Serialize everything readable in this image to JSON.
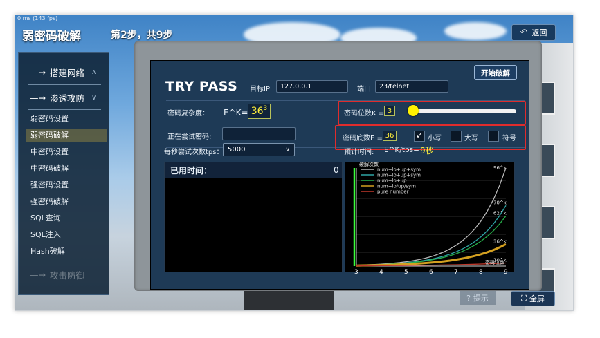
{
  "window": {
    "fps": "0 ms (143 fps)"
  },
  "header": {
    "app_title": "弱密码破解",
    "step": "第2步，共9步",
    "back_label": "返回",
    "back_icon": "back-arrow-icon"
  },
  "sidebar": {
    "sections": [
      {
        "label": "搭建网络",
        "expanded": false
      },
      {
        "label": "渗透攻防",
        "expanded": true
      },
      {
        "label": "攻击防御"
      }
    ],
    "items": [
      {
        "label": "弱密码设置",
        "active": false
      },
      {
        "label": "弱密码破解",
        "active": true
      },
      {
        "label": "中密码设置",
        "active": false
      },
      {
        "label": "中密码破解",
        "active": false
      },
      {
        "label": "强密码设置",
        "active": false
      },
      {
        "label": "强密码破解",
        "active": false
      },
      {
        "label": "SQL查询",
        "active": false
      },
      {
        "label": "SQL注入",
        "active": false
      },
      {
        "label": "Hash破解",
        "active": false
      }
    ]
  },
  "panel": {
    "title": "TRY PASS",
    "target_ip_label": "目标IP",
    "target_ip_value": "127.0.0.1",
    "port_label": "端口",
    "port_value": "23/telnet",
    "start_button": "开始破解",
    "complexity_label": "密码复杂度：",
    "complexity_formula": "E^K=",
    "complexity_base": "36",
    "complexity_exp": "3",
    "digits_label": "密码位数K =",
    "digits_value": "3",
    "digits_slider_fraction": 0.0,
    "trying_label": "正在尝试密码:",
    "trying_value": "",
    "base_label": "密码底数E =",
    "base_value": "36",
    "checkboxes": [
      {
        "label": "小写",
        "checked": true
      },
      {
        "label": "大写",
        "checked": false
      },
      {
        "label": "符号",
        "checked": false
      }
    ],
    "tps_label": "每秒尝试次数tps：",
    "tps_value": "5000",
    "estimate_label": "预计时间:",
    "estimate_formula": "E^K/tps=",
    "estimate_value": "9秒",
    "elapsed_label": "已用时间：",
    "elapsed_value": "0"
  },
  "chart_data": {
    "type": "line",
    "ylabel": "破解次数",
    "xlabel": "密码位数",
    "x": [
      3,
      4,
      5,
      6,
      7,
      8,
      9
    ],
    "x_ticks": [
      "3",
      "4",
      "5",
      "6",
      "7",
      "8",
      "9"
    ],
    "log_scale": true,
    "highlight_x": 3,
    "series": [
      {
        "name": "num+lo+up+sym",
        "base": 96,
        "end_label": "96^k",
        "color": "#b9b9b9"
      },
      {
        "name": "num+lo+up+sym",
        "base": 70,
        "end_label": "70^k",
        "color": "#2fa6a6"
      },
      {
        "name": "num+lo+up",
        "base": 62,
        "end_label": "62^k",
        "color": "#27b04a"
      },
      {
        "name": "num+lo/up/sym",
        "base": 36,
        "end_label": "36^k",
        "color": "#d4a020"
      },
      {
        "name": "pure number",
        "base": 10,
        "end_label": "10^k",
        "color": "#c0392b"
      }
    ]
  },
  "footer": {
    "hint_label": "提示",
    "fullscreen_label": "全屏"
  }
}
